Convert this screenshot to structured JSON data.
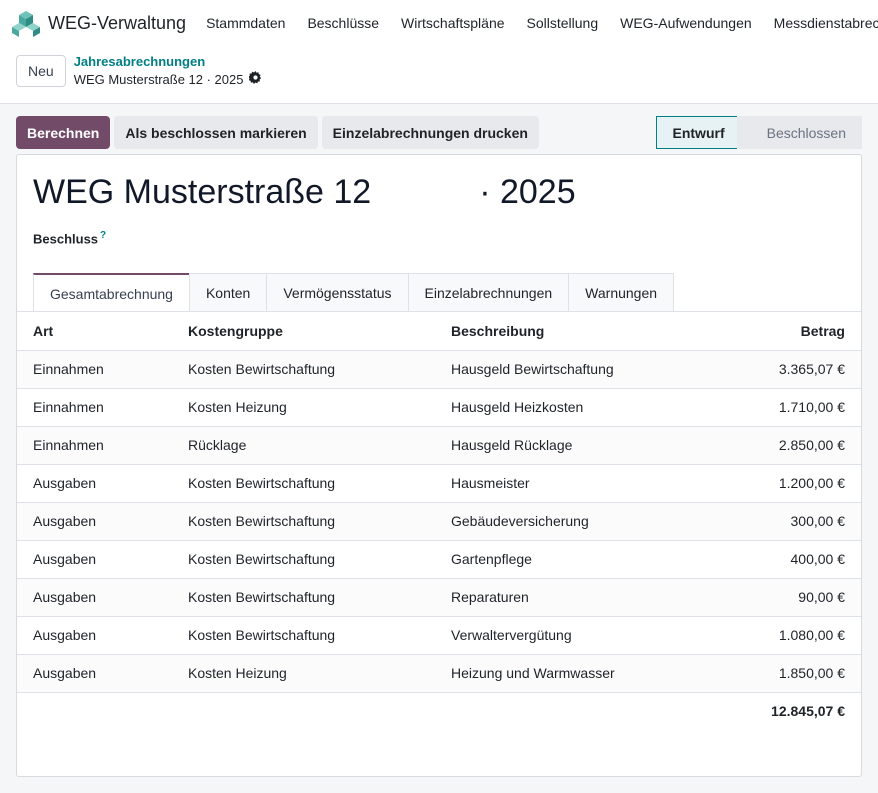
{
  "navbar": {
    "app_title": "WEG-Verwaltung",
    "menu": [
      "Stammdaten",
      "Beschlüsse",
      "Wirtschaftspläne",
      "Sollstellung",
      "WEG-Aufwendungen",
      "Messdienstabrechnu"
    ]
  },
  "control": {
    "new_label": "Neu",
    "breadcrumb": "Jahresabrechnungen",
    "record_title": "WEG Musterstraße 12 · 2025"
  },
  "actions": {
    "compute": "Berechnen",
    "mark_closed": "Als beschlossen markieren",
    "print": "Einzelabrechnungen drucken"
  },
  "status": {
    "active": "Entwurf",
    "next": "Beschlossen"
  },
  "form": {
    "name": "WEG Musterstraße 12",
    "year": "· 2025",
    "beschluss_label": "Beschluss",
    "help": "?"
  },
  "tabs": [
    "Gesamtabrechnung",
    "Konten",
    "Vermögensstatus",
    "Einzelabrechnungen",
    "Warnungen"
  ],
  "table": {
    "headers": {
      "art": "Art",
      "kostengruppe": "Kostengruppe",
      "beschreibung": "Beschreibung",
      "betrag": "Betrag"
    },
    "rows": [
      [
        "Einnahmen",
        "Kosten Bewirtschaftung",
        "Hausgeld Bewirtschaftung",
        "3.365,07 €"
      ],
      [
        "Einnahmen",
        "Kosten Heizung",
        "Hausgeld Heizkosten",
        "1.710,00 €"
      ],
      [
        "Einnahmen",
        "Rücklage",
        "Hausgeld Rücklage",
        "2.850,00 €"
      ],
      [
        "Ausgaben",
        "Kosten Bewirtschaftung",
        "Hausmeister",
        "1.200,00 €"
      ],
      [
        "Ausgaben",
        "Kosten Bewirtschaftung",
        "Gebäudeversicherung",
        "300,00 €"
      ],
      [
        "Ausgaben",
        "Kosten Bewirtschaftung",
        "Gartenpflege",
        "400,00 €"
      ],
      [
        "Ausgaben",
        "Kosten Bewirtschaftung",
        "Reparaturen",
        "90,00 €"
      ],
      [
        "Ausgaben",
        "Kosten Bewirtschaftung",
        "Verwaltervergütung",
        "1.080,00 €"
      ],
      [
        "Ausgaben",
        "Kosten Heizung",
        "Heizung und Warmwasser",
        "1.850,00 €"
      ]
    ],
    "total": "12.845,07 €"
  },
  "colors": {
    "primary": "#714b67",
    "link": "#017e84"
  },
  "icons": {
    "logo": "weg-cubes-logo-icon",
    "settings": "gear-icon"
  }
}
